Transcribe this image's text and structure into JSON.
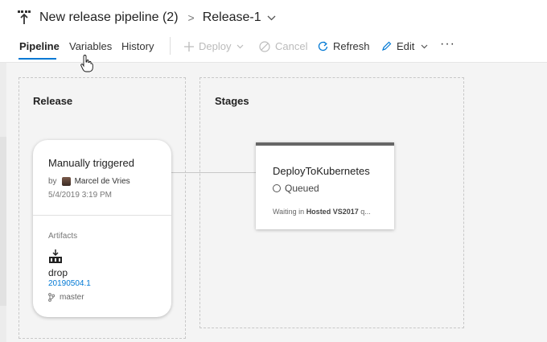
{
  "header": {
    "title": "New release pipeline (2)",
    "separator": ">",
    "release_name": "Release-1"
  },
  "tabs": [
    {
      "label": "Pipeline",
      "active": true
    },
    {
      "label": "Variables",
      "active": false
    },
    {
      "label": "History",
      "active": false
    }
  ],
  "toolbar": {
    "deploy": {
      "label": "Deploy",
      "icon": "plus-icon",
      "enabled": false
    },
    "cancel": {
      "label": "Cancel",
      "icon": "cancel-icon",
      "enabled": false
    },
    "refresh": {
      "label": "Refresh",
      "icon": "refresh-icon",
      "enabled": true
    },
    "edit": {
      "label": "Edit",
      "icon": "pencil-icon",
      "enabled": true
    },
    "more": "···"
  },
  "release_panel": {
    "title": "Release",
    "trigger": {
      "title": "Manually triggered",
      "by_prefix": "by",
      "user": "Marcel de Vries",
      "datetime": "5/4/2019 3:19 PM"
    },
    "artifacts": {
      "label": "Artifacts",
      "name": "drop",
      "build": "20190504.1",
      "branch": "master"
    }
  },
  "stages_panel": {
    "title": "Stages",
    "stage": {
      "name": "DeployToKubernetes",
      "status": "Queued",
      "waiting_prefix": "Waiting in ",
      "waiting_pool": "Hosted VS2017",
      "waiting_suffix": " q..."
    }
  },
  "colors": {
    "accent": "#0078d4",
    "stage_top_border": "#666666",
    "background": "#f4f4f4"
  }
}
